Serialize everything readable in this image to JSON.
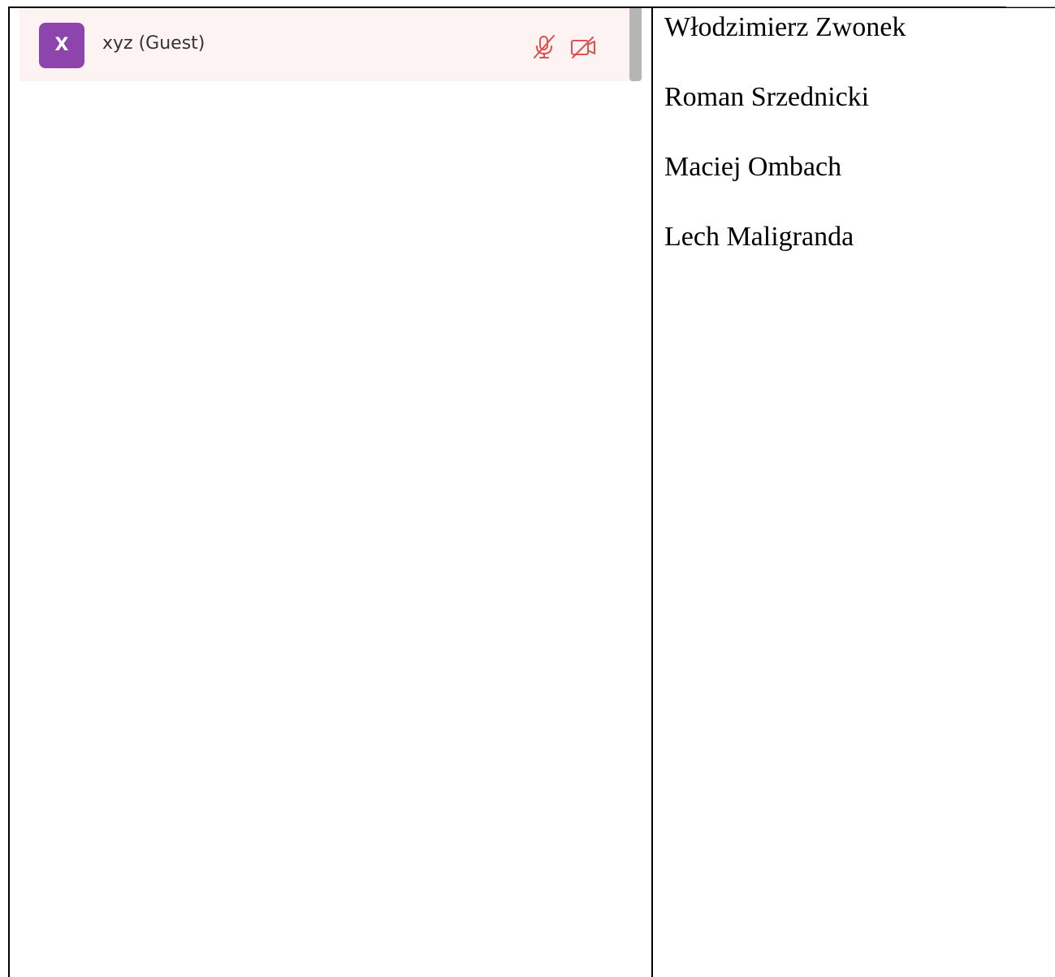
{
  "participants_panel": {
    "participant": {
      "avatar_initial": "X",
      "name": "xyz (Guest)",
      "microphone_icon": "mic-off-icon",
      "camera_icon": "camera-off-icon"
    },
    "colors": {
      "avatar": "#8e44ad",
      "row_highlight": "#fdf3f2",
      "status_icon": "#e05050"
    }
  },
  "names": [
    "Włodzimierz Zwonek",
    "Roman Srzednicki",
    "Maciej Ombach",
    "Lech Maligranda"
  ]
}
